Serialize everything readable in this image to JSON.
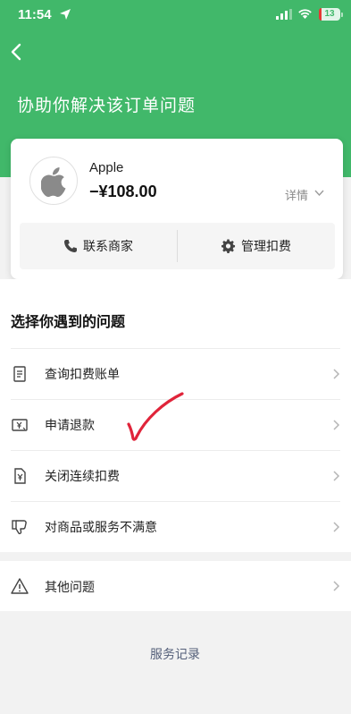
{
  "status_bar": {
    "time": "11:54",
    "battery": "13",
    "icons": [
      "location-arrow-icon",
      "signal-icon",
      "wifi-icon",
      "battery-icon"
    ]
  },
  "colors": {
    "brand_green": "#41b86a",
    "link_blue": "#55607a",
    "annotation_red": "#e0243a"
  },
  "header": {
    "title": "协助你解决该订单问题"
  },
  "order": {
    "merchant": "Apple",
    "amount": "−¥108.00",
    "detail_label": "详情",
    "contact_label": "联系商家",
    "manage_label": "管理扣费"
  },
  "issues": {
    "title": "选择你遇到的问题",
    "items": [
      {
        "label": "查询扣费账单",
        "icon": "receipt-icon"
      },
      {
        "label": "申请退款",
        "icon": "refund-icon"
      },
      {
        "label": "关闭连续扣费",
        "icon": "document-yen-icon"
      },
      {
        "label": "对商品或服务不满意",
        "icon": "thumbs-down-icon"
      }
    ],
    "other": {
      "label": "其他问题",
      "icon": "warning-icon"
    }
  },
  "footer": {
    "service_record": "服务记录"
  }
}
